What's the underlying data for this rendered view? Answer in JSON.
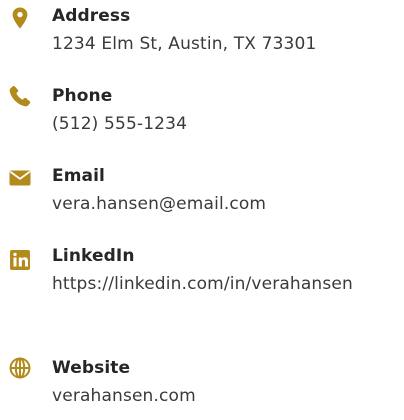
{
  "accent_color": "#b38a1c",
  "contacts": [
    {
      "icon": "map-pin-icon",
      "label": "Address",
      "value": "1234 Elm St, Austin, TX 73301"
    },
    {
      "icon": "phone-icon",
      "label": "Phone",
      "value": "(512) 555-1234"
    },
    {
      "icon": "envelope-icon",
      "label": "Email",
      "value": "vera.hansen@email.com"
    },
    {
      "icon": "linkedin-icon",
      "label": "LinkedIn",
      "value": "https://linkedin.com/in/verahansen"
    },
    {
      "icon": "globe-icon",
      "label": "Website",
      "value": "verahansen.com"
    }
  ]
}
